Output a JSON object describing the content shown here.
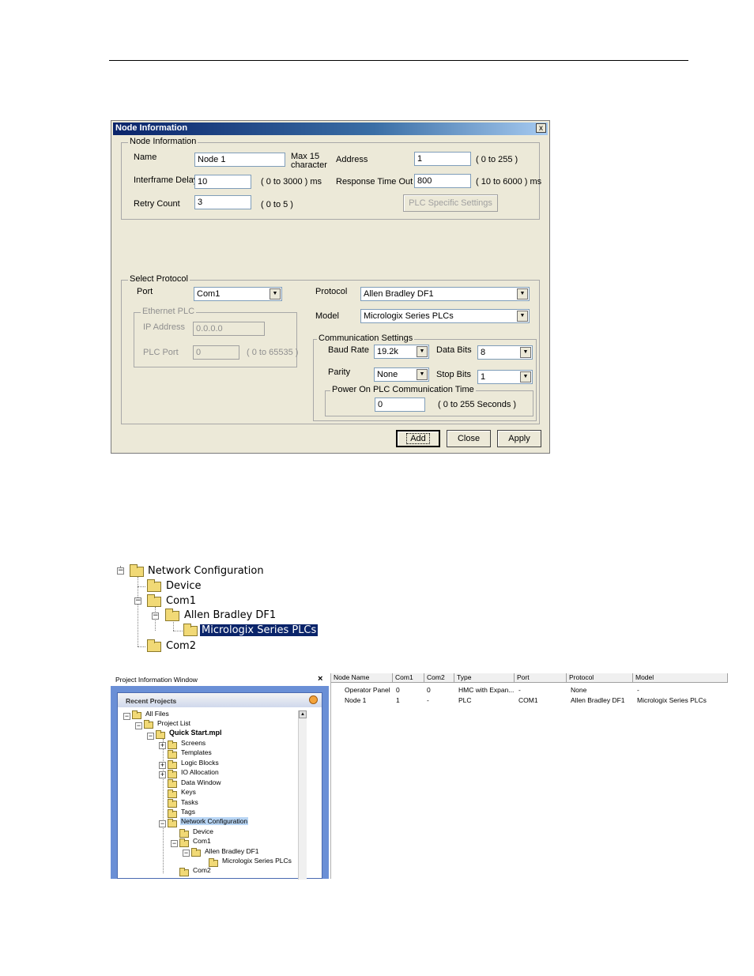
{
  "dialog": {
    "title": "Node Information",
    "close_glyph": "x",
    "node_group": {
      "legend": "Node Information",
      "name_label": "Name",
      "name_value": "Node 1",
      "name_hint": "Max 15\ncharacter",
      "address_label": "Address",
      "address_value": "1",
      "address_hint": "( 0 to 255 )",
      "interframe_label": "Interframe Delay",
      "interframe_value": "10",
      "interframe_hint": "( 0 to 3000 ) ms",
      "response_label": "Response Time Out",
      "response_value": "800",
      "response_hint": "( 10 to 6000 ) ms",
      "retry_label": "Retry Count",
      "retry_value": "3",
      "retry_hint": "( 0 to 5 )",
      "plc_specific_button": "PLC Specific Settings"
    },
    "protocol_group": {
      "legend": "Select Protocol",
      "port_label": "Port",
      "port_value": "Com1",
      "protocol_label": "Protocol",
      "protocol_value": "Allen Bradley DF1",
      "model_label": "Model",
      "model_value": "Micrologix Series PLCs",
      "ethernet": {
        "legend": "Ethernet PLC",
        "ip_label": "IP Address",
        "ip_value": "0.0.0.0",
        "port_label": "PLC Port",
        "port_value": "0",
        "port_hint": "( 0 to 65535 )"
      },
      "comm": {
        "legend": "Communication Settings",
        "baud_label": "Baud Rate",
        "baud_value": "19.2k",
        "databits_label": "Data Bits",
        "databits_value": "8",
        "parity_label": "Parity",
        "parity_value": "None",
        "stopbits_label": "Stop Bits",
        "stopbits_value": "1",
        "power_on": {
          "legend": "Power On PLC Communication Time",
          "value": "0",
          "hint": "( 0 to 255 Seconds )"
        }
      }
    },
    "buttons": {
      "add": "Add",
      "close": "Close",
      "apply": "Apply"
    }
  },
  "tree": {
    "root": "Network Configuration",
    "device": "Device",
    "com1": "Com1",
    "driver": "Allen Bradley DF1",
    "model": "Micrologix Series PLCs",
    "com2": "Com2"
  },
  "project_window": {
    "title": "Project Information Window",
    "close_glyph": "×",
    "recent_projects": "Recent Projects",
    "items": {
      "all_files": "All Files",
      "project_list": "Project List",
      "project": "Quick Start.mpl",
      "screens": "Screens",
      "templates": "Templates",
      "logic_blocks": "Logic Blocks",
      "io_allocation": "IO Allocation",
      "data_window": "Data Window",
      "keys": "Keys",
      "tasks": "Tasks",
      "tags": "Tags",
      "network_configuration": "Network Configuration",
      "device": "Device",
      "com1": "Com1",
      "driver": "Allen Bradley DF1",
      "model": "Micrologix Series PLCs",
      "com2": "Com2"
    }
  },
  "node_table": {
    "headers": [
      "Node Name",
      "Com1",
      "Com2",
      "Type",
      "Port",
      "Protocol",
      "Model"
    ],
    "rows": [
      [
        "Operator Panel",
        "0",
        "0",
        "HMC with Expan...",
        "-",
        "None",
        "-"
      ],
      [
        "Node 1",
        "1",
        "-",
        "PLC",
        "COM1",
        "Allen Bradley DF1",
        "Micrologix Series PLCs"
      ]
    ]
  }
}
